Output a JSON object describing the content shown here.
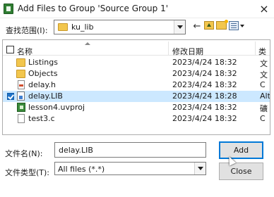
{
  "window": {
    "title": "Add Files to Group 'Source Group 1'",
    "close_label": "×"
  },
  "look_in": {
    "label": "查找范围(I):",
    "value": "ku_lib"
  },
  "toolbar": {
    "back": "←"
  },
  "columns": {
    "name": "名称",
    "date": "修改日期",
    "type": "类"
  },
  "files": [
    {
      "name": "Listings",
      "date": "2023/4/24 18:32",
      "type": "文",
      "icon": "folder-icon",
      "selected": false
    },
    {
      "name": "Objects",
      "date": "2023/4/24 18:32",
      "type": "文",
      "icon": "folder-icon",
      "selected": false
    },
    {
      "name": "delay.h",
      "date": "2023/4/24 18:32",
      "type": "C",
      "icon": "header-file-icon",
      "selected": false
    },
    {
      "name": "delay.LIB",
      "date": "2023/4/24 18:28",
      "type": "Alt",
      "icon": "lib-file-icon",
      "selected": true
    },
    {
      "name": "lesson4.uvproj",
      "date": "2023/4/24 18:32",
      "type": "礦",
      "icon": "project-file-icon",
      "selected": false
    },
    {
      "name": "test3.c",
      "date": "2023/4/24 18:32",
      "type": "C",
      "icon": "c-file-icon",
      "selected": false
    }
  ],
  "file_name": {
    "label": "文件名(N):",
    "value": "delay.LIB"
  },
  "file_type": {
    "label": "文件类型(T):",
    "value": "All files (*.*)"
  },
  "buttons": {
    "add": "Add",
    "close": "Close"
  },
  "colors": {
    "selection": "#cce8ff",
    "accent": "#0078d7"
  }
}
